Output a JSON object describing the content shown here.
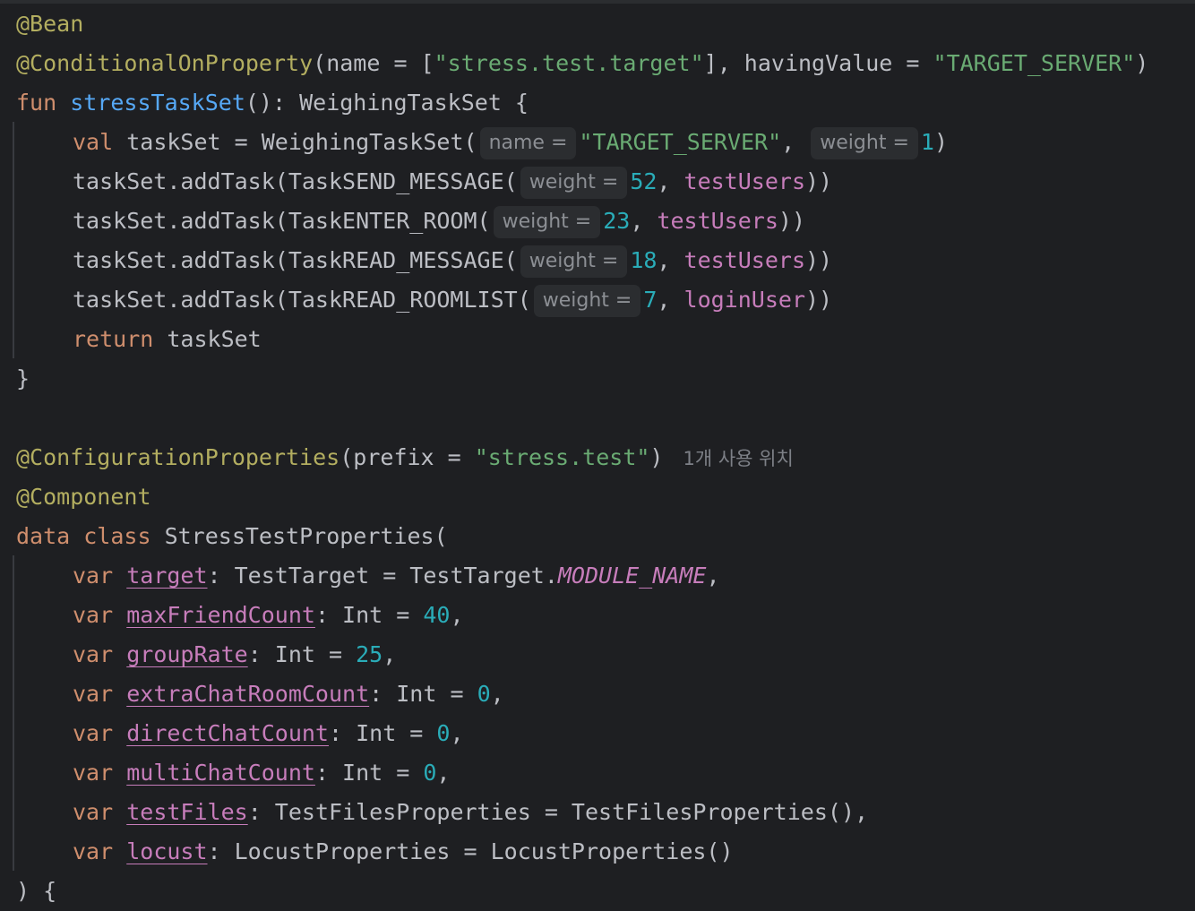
{
  "editor": {
    "lines": [
      {
        "tokens": [
          {
            "t": "@Bean",
            "c": "ann"
          }
        ]
      },
      {
        "tokens": [
          {
            "t": "@ConditionalOnProperty",
            "c": "ann"
          },
          {
            "t": "(name = [",
            "c": "def"
          },
          {
            "t": "\"stress.test.target\"",
            "c": "str"
          },
          {
            "t": "], havingValue = ",
            "c": "def"
          },
          {
            "t": "\"TARGET_SERVER\"",
            "c": "str"
          },
          {
            "t": ")",
            "c": "def"
          }
        ]
      },
      {
        "tokens": [
          {
            "t": "fun ",
            "c": "kw"
          },
          {
            "t": "stressTaskSet",
            "c": "fn"
          },
          {
            "t": "(): WeighingTaskSet {",
            "c": "def"
          }
        ]
      },
      {
        "indent": true,
        "tokens": [
          {
            "t": "val ",
            "c": "kw"
          },
          {
            "t": "taskSet = WeighingTaskSet(",
            "c": "def"
          },
          {
            "t": "name =",
            "c": "hint"
          },
          {
            "t": "\"TARGET_SERVER\"",
            "c": "str"
          },
          {
            "t": ", ",
            "c": "def"
          },
          {
            "t": "weight =",
            "c": "hint"
          },
          {
            "t": "1",
            "c": "num"
          },
          {
            "t": ")",
            "c": "def"
          }
        ]
      },
      {
        "indent": true,
        "tokens": [
          {
            "t": "taskSet.addTask(TaskSEND_MESSAGE(",
            "c": "def"
          },
          {
            "t": "weight =",
            "c": "hint"
          },
          {
            "t": "52",
            "c": "num"
          },
          {
            "t": ", ",
            "c": "def"
          },
          {
            "t": "testUsers",
            "c": "prop"
          },
          {
            "t": "))",
            "c": "def"
          }
        ]
      },
      {
        "indent": true,
        "tokens": [
          {
            "t": "taskSet.addTask(TaskENTER_ROOM(",
            "c": "def"
          },
          {
            "t": "weight =",
            "c": "hint"
          },
          {
            "t": "23",
            "c": "num"
          },
          {
            "t": ", ",
            "c": "def"
          },
          {
            "t": "testUsers",
            "c": "prop"
          },
          {
            "t": "))",
            "c": "def"
          }
        ]
      },
      {
        "indent": true,
        "tokens": [
          {
            "t": "taskSet.addTask(TaskREAD_MESSAGE(",
            "c": "def"
          },
          {
            "t": "weight =",
            "c": "hint"
          },
          {
            "t": "18",
            "c": "num"
          },
          {
            "t": ", ",
            "c": "def"
          },
          {
            "t": "testUsers",
            "c": "prop"
          },
          {
            "t": "))",
            "c": "def"
          }
        ]
      },
      {
        "indent": true,
        "tokens": [
          {
            "t": "taskSet.addTask(TaskREAD_ROOMLIST(",
            "c": "def"
          },
          {
            "t": "weight =",
            "c": "hint"
          },
          {
            "t": "7",
            "c": "num"
          },
          {
            "t": ", ",
            "c": "def"
          },
          {
            "t": "loginUser",
            "c": "prop"
          },
          {
            "t": "))",
            "c": "def"
          }
        ]
      },
      {
        "indent": true,
        "tokens": [
          {
            "t": "return ",
            "c": "kw"
          },
          {
            "t": "taskSet",
            "c": "def"
          }
        ]
      },
      {
        "tokens": [
          {
            "t": "}",
            "c": "def"
          }
        ]
      },
      {
        "tokens": []
      },
      {
        "tokens": [
          {
            "t": "@ConfigurationProperties",
            "c": "ann"
          },
          {
            "t": "(prefix = ",
            "c": "def"
          },
          {
            "t": "\"stress.test\"",
            "c": "str"
          },
          {
            "t": ")",
            "c": "def"
          },
          {
            "t": "1개 사용 위치",
            "c": "usage"
          }
        ]
      },
      {
        "tokens": [
          {
            "t": "@Component",
            "c": "ann"
          }
        ]
      },
      {
        "tokens": [
          {
            "t": "data class ",
            "c": "kw"
          },
          {
            "t": "StressTestProperties(",
            "c": "def"
          }
        ]
      },
      {
        "indent": true,
        "tokens": [
          {
            "t": "var ",
            "c": "kw"
          },
          {
            "t": "target",
            "c": "propu"
          },
          {
            "t": ": TestTarget = TestTarget.",
            "c": "def"
          },
          {
            "t": "MODULE_NAME",
            "c": "enum"
          },
          {
            "t": ",",
            "c": "def"
          }
        ]
      },
      {
        "indent": true,
        "tokens": [
          {
            "t": "var ",
            "c": "kw"
          },
          {
            "t": "maxFriendCount",
            "c": "propu"
          },
          {
            "t": ": Int = ",
            "c": "def"
          },
          {
            "t": "40",
            "c": "num"
          },
          {
            "t": ",",
            "c": "def"
          }
        ]
      },
      {
        "indent": true,
        "tokens": [
          {
            "t": "var ",
            "c": "kw"
          },
          {
            "t": "groupRate",
            "c": "propu"
          },
          {
            "t": ": Int = ",
            "c": "def"
          },
          {
            "t": "25",
            "c": "num"
          },
          {
            "t": ",",
            "c": "def"
          }
        ]
      },
      {
        "indent": true,
        "tokens": [
          {
            "t": "var ",
            "c": "kw"
          },
          {
            "t": "extraChatRoomCount",
            "c": "propu"
          },
          {
            "t": ": Int = ",
            "c": "def"
          },
          {
            "t": "0",
            "c": "num"
          },
          {
            "t": ",",
            "c": "def"
          }
        ]
      },
      {
        "indent": true,
        "tokens": [
          {
            "t": "var ",
            "c": "kw"
          },
          {
            "t": "directChatCount",
            "c": "propu"
          },
          {
            "t": ": Int = ",
            "c": "def"
          },
          {
            "t": "0",
            "c": "num"
          },
          {
            "t": ",",
            "c": "def"
          }
        ]
      },
      {
        "indent": true,
        "tokens": [
          {
            "t": "var ",
            "c": "kw"
          },
          {
            "t": "multiChatCount",
            "c": "propu"
          },
          {
            "t": ": Int = ",
            "c": "def"
          },
          {
            "t": "0",
            "c": "num"
          },
          {
            "t": ",",
            "c": "def"
          }
        ]
      },
      {
        "indent": true,
        "tokens": [
          {
            "t": "var ",
            "c": "kw"
          },
          {
            "t": "testFiles",
            "c": "propu"
          },
          {
            "t": ": TestFilesProperties = TestFilesProperties(),",
            "c": "def"
          }
        ]
      },
      {
        "indent": true,
        "tokens": [
          {
            "t": "var ",
            "c": "kw"
          },
          {
            "t": "locust",
            "c": "propu"
          },
          {
            "t": ": LocustProperties = LocustProperties()",
            "c": "def"
          }
        ]
      },
      {
        "tokens": [
          {
            "t": ") {",
            "c": "def"
          }
        ]
      }
    ]
  },
  "colors": {
    "background": "#1e1f22",
    "annotation": "#b3ae60",
    "keyword": "#cf8e6d",
    "function": "#56a8f5",
    "string": "#6aab73",
    "number": "#2aacb8",
    "property": "#c77dbb",
    "default_text": "#bcbec4",
    "inlay_hint_bg": "#2b2d30"
  }
}
